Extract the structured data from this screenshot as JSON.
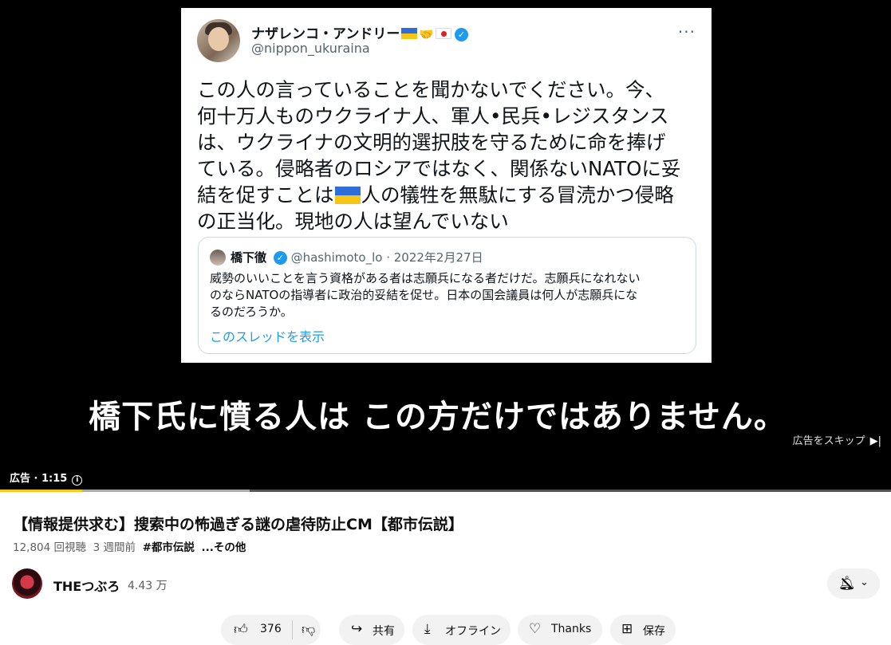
{
  "tweet": {
    "display_name": "ナザレンコ・アンドリー",
    "handle": "@nippon_ukuraina",
    "more": "···",
    "body": {
      "line1": "この人の言っていることを聞かないでください。今、",
      "line2": "何十万人ものウクライナ人、軍人•民兵•レジスタンス",
      "line3": "は、ウクライナの文明的選択肢を守るために命を捧げ",
      "line4": "ている。侵略者のロシアではなく、関係ないNATOに妥",
      "line5a": "結を促すことは",
      "line5b": "人の犠牲を無駄にする冒涜かつ侵略",
      "line6": "の正当化。現地の人は望んでいない"
    },
    "quote": {
      "name": "橋下徹",
      "handle_date": "@hashimoto_lo · 2022年2月27日",
      "line1": "威勢のいいことを言う資格がある者は志願兵になる者だけだ。志願兵になれない",
      "line2": "のならNATOの指導者に政治的妥結を促せ。日本の国会議員は何人が志願兵にな",
      "line3": "るのだろうか。",
      "thread_link": "このスレッドを表示"
    }
  },
  "player": {
    "caption": "橋下氏に憤る人は この方だけではありません。",
    "skip_label": "広告をスキップ",
    "skip_icon": "▶|",
    "ad_label": "広告 · 1:15",
    "info_icon": "i",
    "progress_fraction": 0.092,
    "loaded_fraction": 0.28
  },
  "video": {
    "title": "【情報提供求む】搜索中の怖過ぎる謎の虐待防止CM【都市伝説】",
    "views": "12,804 回視聴",
    "age": "3 週間前",
    "hashtag": "#都市伝説",
    "more": "...その他"
  },
  "channel": {
    "name": "THEつぶろ",
    "subscribers": "4.43 万"
  },
  "actions": {
    "like_count": "376",
    "share": "共有",
    "offline": "オフライン",
    "thanks": "Thanks",
    "save": "保存"
  },
  "colors": {
    "ad_progress": "#f8c91a",
    "twitter_blue": "#1d9bf0"
  }
}
